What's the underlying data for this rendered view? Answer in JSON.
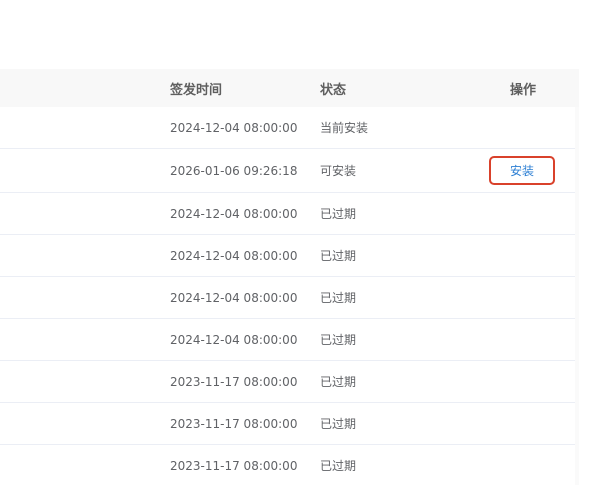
{
  "table": {
    "headers": {
      "issue_time": "签发时间",
      "status": "状态",
      "action": "操作"
    },
    "rows": [
      {
        "issue_time": "2024-12-04 08:00:00",
        "status": "当前安装",
        "action": ""
      },
      {
        "issue_time": "2026-01-06 09:26:18",
        "status": "可安装",
        "action": "安装"
      },
      {
        "issue_time": "2024-12-04 08:00:00",
        "status": "已过期",
        "action": ""
      },
      {
        "issue_time": "2024-12-04 08:00:00",
        "status": "已过期",
        "action": ""
      },
      {
        "issue_time": "2024-12-04 08:00:00",
        "status": "已过期",
        "action": ""
      },
      {
        "issue_time": "2024-12-04 08:00:00",
        "status": "已过期",
        "action": ""
      },
      {
        "issue_time": "2023-11-17 08:00:00",
        "status": "已过期",
        "action": ""
      },
      {
        "issue_time": "2023-11-17 08:00:00",
        "status": "已过期",
        "action": ""
      },
      {
        "issue_time": "2023-11-17 08:00:00",
        "status": "已过期",
        "action": ""
      }
    ]
  },
  "colors": {
    "accent_link": "#2d7fd3",
    "highlight_border": "#d9412b",
    "header_bg": "#f8f8f8"
  }
}
